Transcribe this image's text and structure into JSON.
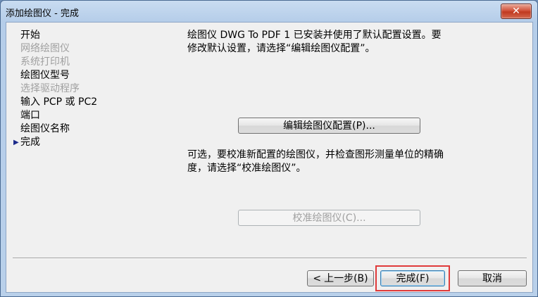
{
  "window": {
    "title": "添加绘图仪 - 完成",
    "close_label": "✕"
  },
  "steps": {
    "items": [
      {
        "label": "开始",
        "state": "enabled"
      },
      {
        "label": "网络绘图仪",
        "state": "disabled"
      },
      {
        "label": "系统打印机",
        "state": "disabled"
      },
      {
        "label": "绘图仪型号",
        "state": "enabled"
      },
      {
        "label": "选择驱动程序",
        "state": "disabled"
      },
      {
        "label": "输入 PCP 或 PC2",
        "state": "enabled"
      },
      {
        "label": "端口",
        "state": "enabled"
      },
      {
        "label": "绘图仪名称",
        "state": "enabled"
      },
      {
        "label": "完成",
        "state": "current"
      }
    ],
    "current_marker": "▶"
  },
  "content": {
    "description1": "绘图仪 DWG To PDF 1 已安装并使用了默认配置设置。要\n修改默认设置，请选择“编辑绘图仪配置”。",
    "edit_button": "编辑绘图仪配置(P)...",
    "description2": "可选，要校准新配置的绘图仪，并检查图形测量单位的精确\n度，请选择“校准绘图仪”。",
    "calibrate_button": "校准绘图仪(C)..."
  },
  "footer": {
    "back_arrow": "<",
    "back_label": "上一步(B)",
    "finish_label": "完成(F)",
    "cancel_label": "取消"
  }
}
